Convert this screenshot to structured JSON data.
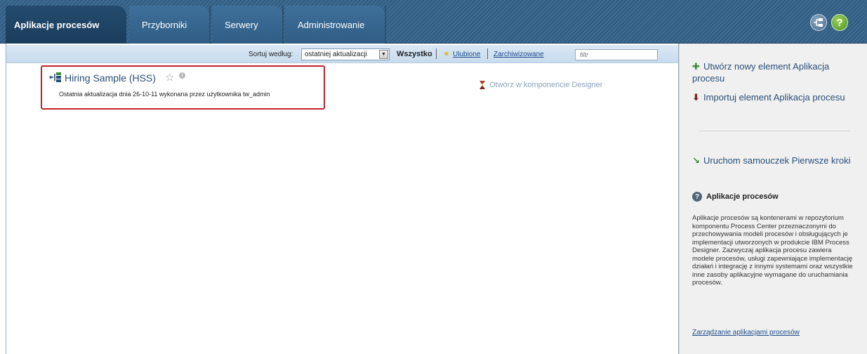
{
  "nav": {
    "tabs": [
      {
        "label": "Aplikacje procesów",
        "active": true
      },
      {
        "label": "Przyborniki",
        "active": false
      },
      {
        "label": "Serwery",
        "active": false
      },
      {
        "label": "Administrowanie",
        "active": false
      }
    ],
    "tools_icon": "toolkit-icon",
    "help_label": "?"
  },
  "toolbar": {
    "sort_label": "Sortuj według:",
    "sort_selected": "ostatniej aktualizacji",
    "filter_all": "Wszystko",
    "filter_favorites": "Ulubione",
    "filter_archived": "Zarchiwizowane",
    "filter_placeholder": "filtr"
  },
  "app_list": [
    {
      "title": "Hiring Sample (HSS)",
      "description": "Ostatnia aktualizacja dnia 26-10-11 wykonana przez użytkownika tw_admin",
      "open_designer": "Otwórz w komponencie Designer"
    }
  ],
  "sidebar": {
    "create_label": "Utwórz nowy element Aplikacja procesu",
    "import_label": "Importuj element Aplikacja procesu",
    "tutorial_label": "Uruchom samouczek Pierwsze kroki",
    "help_title": "Aplikacje procesów",
    "help_text": "Aplikacje procesów są kontenerami w repozytorium komponentu Process Center przeznaczonymi do przechowywania modeli procesów i obsługujących je implementacji utworzonych w produkcie IBM Process Designer. Zazwyczaj aplikacja procesu zawiera modele procesów, usługi zapewniające implementację działań i integrację z innymi systemami oraz wszystkie inne zasoby aplikacyjne wymagane do uruchamiania procesów.",
    "help_link": "Zarządzanie aplikacjami procesów"
  },
  "colors": {
    "accent": "#34628a",
    "highlight_border": "#c0202a",
    "link": "#1d4d8c"
  }
}
